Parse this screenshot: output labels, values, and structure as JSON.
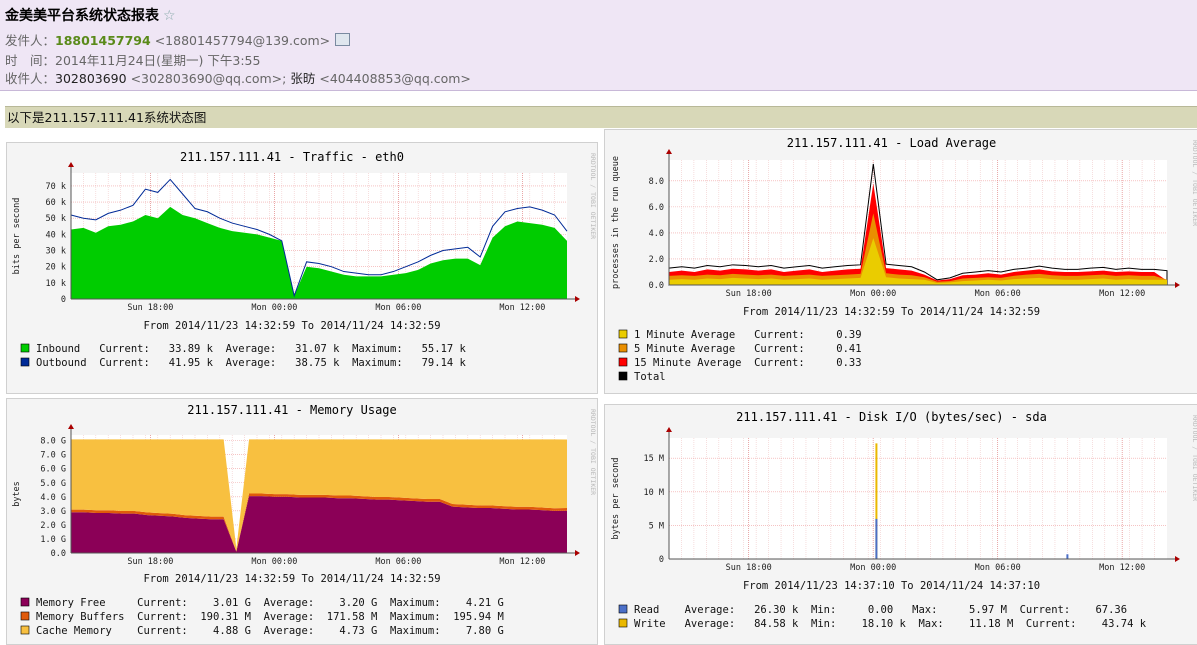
{
  "email": {
    "subject": "金美美平台系统状态报表",
    "star_icon": "☆",
    "sender_label": "发件人：",
    "sender_name": "18801457794",
    "sender_addr": "<18801457794@139.com>",
    "time_label": "时　间：",
    "time_value": "2014年11月24日(星期一) 下午3:55",
    "recipients_label": "收件人：",
    "recipient1_name": "302803690",
    "recipient1_addr": "<302803690@qq.com>;",
    "recipient2_name": "张昉",
    "recipient2_addr": "<404408853@qq.com>"
  },
  "banner": "以下是211.157.111.41系统状态图",
  "side_text": "RRDTOOL / TOBI OETIKER",
  "colors": {
    "inbound": "#00cc00",
    "outbound": "#002a97",
    "mem_free": "#8b0057",
    "mem_buffers": "#e05a0a",
    "mem_cache": "#f8c040",
    "load1": "#eacc00",
    "load5": "#ea8f00",
    "load15": "#ff0000",
    "read": "#4b6fc8",
    "write": "#eab800"
  },
  "chart_data": [
    {
      "type": "area",
      "title": "211.157.111.41 - Traffic - eth0",
      "ylabel": "bits per second",
      "xlabel": "",
      "ylim": [
        0,
        78
      ],
      "y_unit": "k",
      "yticks": [
        "0",
        "10 k",
        "20 k",
        "30 k",
        "40 k",
        "50 k",
        "60 k",
        "70 k"
      ],
      "xticks": [
        "Sun 18:00",
        "Mon 00:00",
        "Mon 06:00",
        "Mon 12:00"
      ],
      "period": "From 2014/11/23 14:32:59 To 2014/11/24 14:32:59",
      "series": [
        {
          "name": "Inbound",
          "values": [
            43,
            44,
            41,
            45,
            46,
            48,
            52,
            50,
            57,
            52,
            50,
            47,
            44,
            42,
            41,
            40,
            38,
            36,
            2,
            20,
            19,
            17,
            15,
            14,
            14,
            14,
            15,
            16,
            18,
            22,
            24,
            25,
            25,
            21,
            38,
            45,
            48,
            47,
            46,
            44,
            36
          ],
          "legend": "Inbound   Current:   33.89 k  Average:   31.07 k  Maximum:   55.17 k"
        },
        {
          "name": "Outbound",
          "values": [
            52,
            50,
            49,
            53,
            55,
            58,
            68,
            66,
            74,
            65,
            56,
            54,
            50,
            47,
            45,
            43,
            40,
            36,
            2,
            23,
            22,
            20,
            17,
            16,
            15,
            15,
            17,
            20,
            23,
            27,
            30,
            31,
            32,
            26,
            45,
            54,
            56,
            57,
            55,
            52,
            42
          ],
          "legend": "Outbound  Current:   41.95 k  Average:   38.75 k  Maximum:   79.14 k"
        }
      ]
    },
    {
      "type": "area",
      "title": "211.157.111.41 - Load Average",
      "ylabel": "processes in the run queue",
      "xlabel": "",
      "ylim": [
        0,
        9.6
      ],
      "yticks": [
        "0.0",
        "2.0",
        "4.0",
        "6.0",
        "8.0"
      ],
      "xticks": [
        "Sun 18:00",
        "Mon 00:00",
        "Mon 06:00",
        "Mon 12:00"
      ],
      "period": "From 2014/11/23 14:32:59 To 2014/11/24 14:32:59",
      "series": [
        {
          "name": "1 Minute Average",
          "values": [
            0.4,
            0.45,
            0.4,
            0.5,
            0.45,
            0.55,
            0.5,
            0.45,
            0.5,
            0.4,
            0.45,
            0.5,
            0.4,
            0.45,
            0.5,
            0.55,
            3.6,
            0.6,
            0.5,
            0.45,
            0.4,
            0.15,
            0.2,
            0.3,
            0.35,
            0.4,
            0.35,
            0.45,
            0.5,
            0.55,
            0.45,
            0.4,
            0.4,
            0.45,
            0.5,
            0.4,
            0.45,
            0.4,
            0.4,
            0.39
          ],
          "legend": "1 Minute Average   Current:     0.39"
        },
        {
          "name": "5 Minute Average",
          "values": [
            0.7,
            0.75,
            0.7,
            0.8,
            0.75,
            0.85,
            0.8,
            0.75,
            0.8,
            0.7,
            0.75,
            0.8,
            0.7,
            0.75,
            0.8,
            0.85,
            5.5,
            0.9,
            0.8,
            0.75,
            0.6,
            0.25,
            0.3,
            0.5,
            0.55,
            0.6,
            0.55,
            0.7,
            0.8,
            0.85,
            0.75,
            0.7,
            0.7,
            0.75,
            0.8,
            0.7,
            0.75,
            0.7,
            0.7,
            0.41
          ],
          "legend": "5 Minute Average   Current:     0.41"
        },
        {
          "name": "15 Minute Average",
          "values": [
            1.0,
            1.1,
            1.0,
            1.2,
            1.1,
            1.25,
            1.2,
            1.1,
            1.2,
            1.0,
            1.1,
            1.2,
            1.0,
            1.1,
            1.2,
            1.25,
            7.8,
            1.3,
            1.2,
            1.1,
            0.8,
            0.35,
            0.45,
            0.75,
            0.8,
            0.9,
            0.8,
            1.0,
            1.1,
            1.2,
            1.05,
            1.0,
            1.0,
            1.05,
            1.1,
            1.0,
            1.05,
            1.0,
            1.0,
            0.33
          ],
          "legend": "15 Minute Average  Current:     0.33"
        },
        {
          "name": "Total",
          "values": [
            1.3,
            1.4,
            1.3,
            1.5,
            1.4,
            1.55,
            1.5,
            1.4,
            1.5,
            1.3,
            1.4,
            1.5,
            1.3,
            1.4,
            1.5,
            1.55,
            9.3,
            1.6,
            1.5,
            1.4,
            1.0,
            0.4,
            0.55,
            0.9,
            1.0,
            1.1,
            1.0,
            1.2,
            1.3,
            1.45,
            1.3,
            1.2,
            1.2,
            1.3,
            1.35,
            1.2,
            1.3,
            1.2,
            1.2,
            1.1
          ],
          "legend": "Total"
        }
      ]
    },
    {
      "type": "area",
      "title": "211.157.111.41 - Memory Usage",
      "ylabel": "bytes",
      "xlabel": "",
      "ylim": [
        0,
        8.4
      ],
      "yticks": [
        "0.0",
        "1.0 G",
        "2.0 G",
        "3.0 G",
        "4.0 G",
        "5.0 G",
        "6.0 G",
        "7.0 G",
        "8.0 G"
      ],
      "xticks": [
        "Sun 18:00",
        "Mon 00:00",
        "Mon 06:00",
        "Mon 12:00"
      ],
      "period": "From 2014/11/23 14:32:59 To 2014/11/24 14:32:59",
      "series": [
        {
          "name": "Memory Free",
          "values": [
            2.9,
            2.9,
            2.85,
            2.85,
            2.8,
            2.8,
            2.7,
            2.65,
            2.6,
            2.5,
            2.45,
            2.4,
            2.4,
            0.1,
            4.05,
            4.05,
            4.0,
            4.0,
            3.95,
            3.95,
            3.95,
            3.9,
            3.9,
            3.85,
            3.8,
            3.8,
            3.75,
            3.7,
            3.65,
            3.65,
            3.3,
            3.25,
            3.2,
            3.2,
            3.15,
            3.1,
            3.1,
            3.05,
            3.0,
            3.01
          ],
          "legend": "Memory Free     Current:    3.01 G  Average:    3.20 G  Maximum:    4.21 G"
        },
        {
          "name": "Memory Buffers",
          "values": [
            0.19,
            0.19,
            0.19,
            0.19,
            0.19,
            0.19,
            0.19,
            0.19,
            0.19,
            0.19,
            0.19,
            0.19,
            0.19,
            0.02,
            0.19,
            0.19,
            0.19,
            0.19,
            0.19,
            0.19,
            0.19,
            0.19,
            0.19,
            0.19,
            0.19,
            0.19,
            0.19,
            0.19,
            0.19,
            0.19,
            0.19,
            0.19,
            0.19,
            0.19,
            0.19,
            0.19,
            0.19,
            0.19,
            0.19,
            0.19
          ],
          "legend": "Memory Buffers  Current:  190.31 M  Average:  171.58 M  Maximum:  195.94 M"
        },
        {
          "name": "Cache Memory",
          "values": [
            5.0,
            5.0,
            5.05,
            5.05,
            5.1,
            5.1,
            5.2,
            5.25,
            5.3,
            5.4,
            5.45,
            5.5,
            5.5,
            0.2,
            3.85,
            3.85,
            3.9,
            3.9,
            3.95,
            3.95,
            3.95,
            4.0,
            4.0,
            4.05,
            4.1,
            4.1,
            4.15,
            4.2,
            4.25,
            4.25,
            4.6,
            4.65,
            4.7,
            4.7,
            4.75,
            4.8,
            4.8,
            4.85,
            4.9,
            4.88
          ],
          "legend": "Cache Memory    Current:    4.88 G  Average:    4.73 G  Maximum:    7.80 G"
        }
      ]
    },
    {
      "type": "area",
      "title": "211.157.111.41 - Disk I/O (bytes/sec) - sda",
      "ylabel": "bytes per second",
      "xlabel": "",
      "ylim": [
        0,
        18
      ],
      "yticks": [
        "0",
        "5 M",
        "10 M",
        "15 M"
      ],
      "xticks": [
        "Sun 18:00",
        "Mon 00:00",
        "Mon 06:00",
        "Mon 12:00"
      ],
      "period": "From 2014/11/23 14:37:10 To 2014/11/24 14:37:10",
      "series": [
        {
          "name": "Read",
          "spikes": [
            [
              0.4165,
              5.97
            ],
            [
              0.8,
              0.7
            ]
          ],
          "legend": "Read    Average:   26.30 k  Min:     0.00   Max:     5.97 M  Current:    67.36"
        },
        {
          "name": "Write",
          "spikes": [
            [
              0.4165,
              17.2
            ]
          ],
          "legend": "Write   Average:   84.58 k  Min:    18.10 k  Max:    11.18 M  Current:    43.74 k"
        }
      ]
    }
  ]
}
